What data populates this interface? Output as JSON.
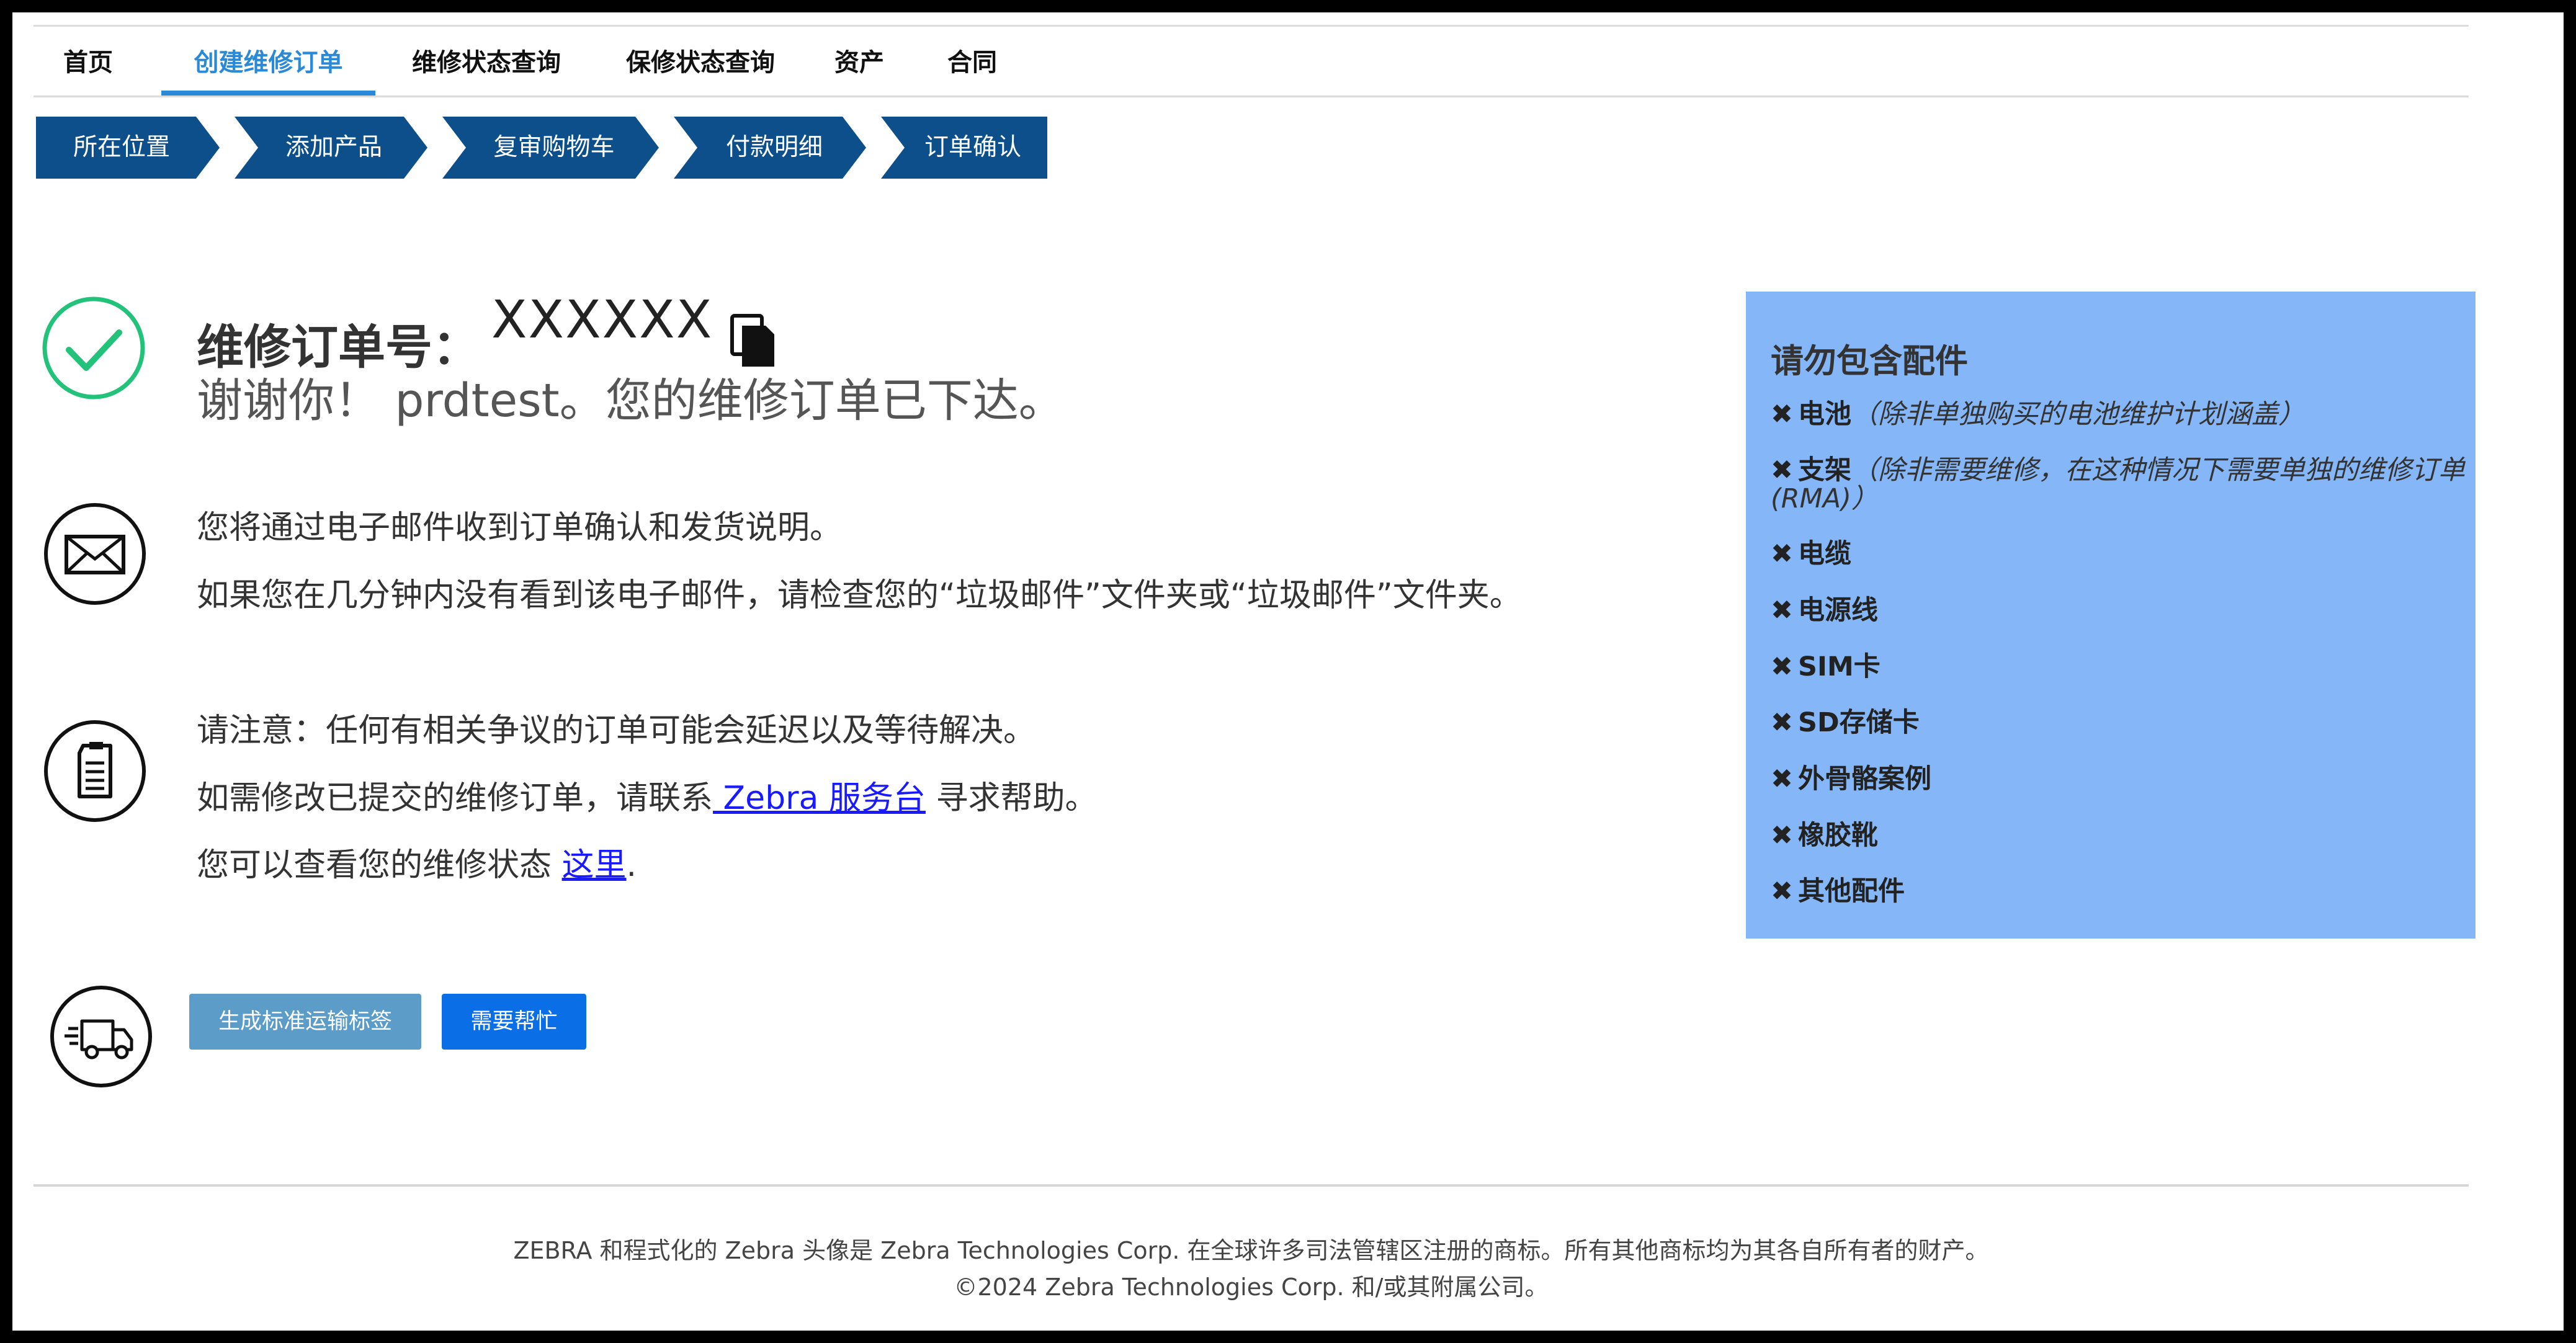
{
  "nav": {
    "items": [
      {
        "label": "首页",
        "active": false
      },
      {
        "label": "创建维修订单",
        "active": true
      },
      {
        "label": "维修状态查询",
        "active": false
      },
      {
        "label": "保修状态查询",
        "active": false
      },
      {
        "label": "资产",
        "active": false
      },
      {
        "label": "合同",
        "active": false
      }
    ]
  },
  "steps": [
    "所在位置",
    "添加产品",
    "复审购物车",
    "付款明细",
    "订单确认"
  ],
  "confirmation": {
    "order_label": "维修订单号：",
    "order_number": "XXXXXX",
    "thanks": "谢谢你！ prdtest。您的维修订单已下达。"
  },
  "email_info": {
    "line1": "您将通过电子邮件收到订单确认和发货说明。",
    "line2": "如果您在几分钟内没有看到该电子邮件，请检查您的“垃圾邮件”文件夹或“垃圾邮件”文件夹。"
  },
  "notice": {
    "line1": "请注意：任何有相关争议的订单可能会延迟以及等待解决。",
    "line2_prefix": "如需修改已提交的维修订单，请联系",
    "service_desk_link": " Zebra 服务台",
    "line2_suffix": " 寻求帮助。",
    "line3_prefix": "您可以查看您的维修状态 ",
    "here_link": "这里",
    "line3_suffix": "."
  },
  "buttons": {
    "ship_label": "生成标准运输标签",
    "help_label": "需要帮忙"
  },
  "accessories": {
    "title": "请勿包含配件",
    "items": [
      {
        "name": "电池",
        "note": "（除非单独购买的电池维护计划涵盖）"
      },
      {
        "name": "支架",
        "note": "（除非需要维修，在这种情况下需要单独的维修订单 (RMA)）"
      },
      {
        "name": "电缆",
        "note": ""
      },
      {
        "name": "电源线",
        "note": ""
      },
      {
        "name": "SIM卡",
        "note": ""
      },
      {
        "name": "SD存储卡",
        "note": ""
      },
      {
        "name": "外骨骼案例",
        "note": ""
      },
      {
        "name": "橡胶靴",
        "note": ""
      },
      {
        "name": "其他配件",
        "note": ""
      }
    ]
  },
  "footer": {
    "line1": "ZEBRA 和程式化的 Zebra 头像是 Zebra Technologies Corp. 在全球许多司法管辖区注册的商标。所有其他商标均为其各自所有者的财产。",
    "line2": "©2024 Zebra Technologies Corp. 和/或其附属公司。"
  },
  "colors": {
    "brand_blue": "#0d4f8b",
    "active_tab": "#2b8ad8",
    "panel_bg": "#85b7f8",
    "success_green": "#22c27a",
    "help_button": "#0a6fe6",
    "ship_button": "#5b9cc9"
  },
  "icons": [
    "check-circle-icon",
    "copy-icon",
    "envelope-icon",
    "document-icon",
    "truck-icon",
    "x-icon"
  ]
}
